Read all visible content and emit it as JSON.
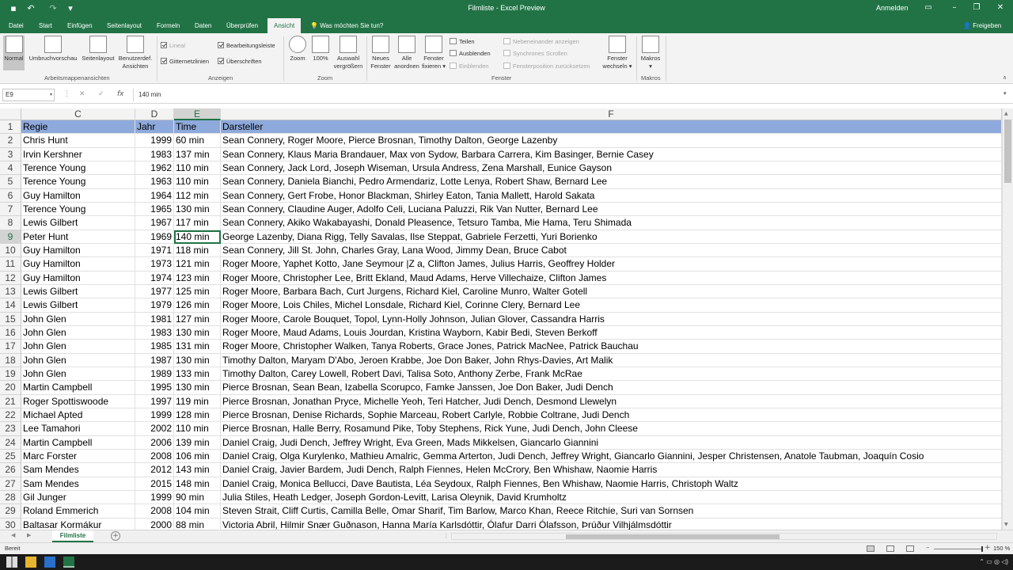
{
  "window": {
    "title": "Filmliste  -  Excel Preview",
    "signin": "Anmelden",
    "share": "Freigeben",
    "tell_me": "Was möchten Sie tun?"
  },
  "tabs": [
    {
      "label": "Datei"
    },
    {
      "label": "Start"
    },
    {
      "label": "Einfügen"
    },
    {
      "label": "Seitenlayout"
    },
    {
      "label": "Formeln"
    },
    {
      "label": "Daten"
    },
    {
      "label": "Überprüfen"
    },
    {
      "label": "Ansicht",
      "active": true
    }
  ],
  "ribbon": {
    "views": {
      "normal": "Normal",
      "pagebreak": "Umbruchvorschau",
      "pagelayout": "Seitenlayout",
      "custom_line1": "Benutzerdef.",
      "custom_line2": "Ansichten",
      "group": "Arbeitsmappenansichten"
    },
    "show": {
      "ruler": "Lineal",
      "formulabar": "Bearbeitungsleiste",
      "gridlines": "Gitternetzlinien",
      "headings": "Überschriften",
      "group": "Anzeigen"
    },
    "zoom": {
      "zoom": "Zoom",
      "hundred": "100%",
      "sel_line1": "Auswahl",
      "sel_line2": "vergrößern",
      "group": "Zoom"
    },
    "window": {
      "new_line1": "Neues",
      "new_line2": "Fenster",
      "arrange_line1": "Alle",
      "arrange_line2": "anordnen",
      "freeze_line1": "Fenster",
      "freeze_line2": "fixieren",
      "split": "Teilen",
      "hide": "Ausblenden",
      "unhide": "Einblenden",
      "side_by_side": "Nebeneinander anzeigen",
      "sync_scroll": "Synchrones Scrollen",
      "reset_pos": "Fensterposition zurücksetzen",
      "switch_line1": "Fenster",
      "switch_line2": "wechseln",
      "group": "Fenster"
    },
    "macros": {
      "label": "Makros",
      "group": "Makros"
    }
  },
  "formula_bar": {
    "name_box": "E9",
    "cancel": "✕",
    "enter": "✓",
    "fx": "fx",
    "value": "140 min"
  },
  "columns": [
    {
      "letter": "C"
    },
    {
      "letter": "D"
    },
    {
      "letter": "E",
      "selected": true
    },
    {
      "letter": "F"
    }
  ],
  "rows": [
    {
      "n": "1",
      "c": "Regie",
      "d": "Jahr",
      "e": "Time",
      "f": "Darsteller"
    },
    {
      "n": "2",
      "c": "Chris Hunt",
      "d": "1999",
      "e": "60 min",
      "f": "Sean Connery, Roger Moore, Pierce Brosnan, Timothy Dalton, George Lazenby"
    },
    {
      "n": "3",
      "c": "Irvin Kershner",
      "d": "1983",
      "e": "137 min",
      "f": "Sean Connery, Klaus Maria Brandauer, Max von Sydow, Barbara Carrera, Kim Basinger, Bernie Casey"
    },
    {
      "n": "4",
      "c": "Terence Young",
      "d": "1962",
      "e": "110 min",
      "f": "Sean Connery, Jack Lord, Joseph Wiseman, Ursula Andress, Zena Marshall, Eunice Gayson"
    },
    {
      "n": "5",
      "c": "Terence Young",
      "d": "1963",
      "e": "110 min",
      "f": "Sean Connery, Daniela Bianchi, Pedro Armendariz, Lotte Lenya, Robert Shaw, Bernard Lee"
    },
    {
      "n": "6",
      "c": "Guy Hamilton",
      "d": "1964",
      "e": "112 min",
      "f": "Sean Connery, Gert Frobe, Honor Blackman, Shirley Eaton, Tania Mallett, Harold Sakata"
    },
    {
      "n": "7",
      "c": "Terence Young",
      "d": "1965",
      "e": "130 min",
      "f": "Sean Connery, Claudine Auger, Adolfo Celi, Luciana Paluzzi, Rik Van Nutter, Bernard Lee"
    },
    {
      "n": "8",
      "c": "Lewis Gilbert",
      "d": "1967",
      "e": "117 min",
      "f": "Sean Connery, Akiko Wakabayashi, Donald Pleasence, Tetsuro Tamba, Mie Hama, Teru Shimada"
    },
    {
      "n": "9",
      "c": "Peter Hunt",
      "d": "1969",
      "e": "140 min",
      "f": "George Lazenby, Diana Rigg, Telly Savalas, Ilse Steppat, Gabriele Ferzetti, Yuri Borienko"
    },
    {
      "n": "10",
      "c": "Guy Hamilton",
      "d": "1971",
      "e": "118 min",
      "f": "Sean Connery, Jill St. John, Charles Gray, Lana Wood, Jimmy Dean, Bruce Cabot"
    },
    {
      "n": "11",
      "c": "Guy Hamilton",
      "d": "1973",
      "e": "121 min",
      "f": "Roger Moore, Yaphet Kotto, Jane Seymour |Z a, Clifton James, Julius Harris, Geoffrey Holder"
    },
    {
      "n": "12",
      "c": "Guy Hamilton",
      "d": "1974",
      "e": "123 min",
      "f": "Roger Moore, Christopher Lee, Britt Ekland, Maud Adams, Herve Villechaize, Clifton James"
    },
    {
      "n": "13",
      "c": "Lewis Gilbert",
      "d": "1977",
      "e": "125 min",
      "f": "Roger Moore, Barbara Bach, Curt Jurgens, Richard Kiel, Caroline Munro, Walter Gotell"
    },
    {
      "n": "14",
      "c": "Lewis Gilbert",
      "d": "1979",
      "e": "126 min",
      "f": "Roger Moore, Lois Chiles, Michel Lonsdale, Richard Kiel, Corinne Clery, Bernard Lee"
    },
    {
      "n": "15",
      "c": "John Glen",
      "d": "1981",
      "e": "127 min",
      "f": "Roger Moore, Carole Bouquet, Topol, Lynn-Holly Johnson, Julian Glover, Cassandra Harris"
    },
    {
      "n": "16",
      "c": "John Glen",
      "d": "1983",
      "e": "130 min",
      "f": "Roger Moore, Maud Adams, Louis Jourdan, Kristina Wayborn, Kabir Bedi, Steven Berkoff"
    },
    {
      "n": "17",
      "c": "John Glen",
      "d": "1985",
      "e": "131 min",
      "f": "Roger Moore, Christopher Walken, Tanya Roberts, Grace Jones, Patrick MacNee, Patrick Bauchau"
    },
    {
      "n": "18",
      "c": "John Glen",
      "d": "1987",
      "e": "130 min",
      "f": "Timothy Dalton, Maryam D'Abo, Jeroen Krabbe, Joe Don Baker, John Rhys-Davies, Art Malik"
    },
    {
      "n": "19",
      "c": "John Glen",
      "d": "1989",
      "e": "133 min",
      "f": "Timothy Dalton, Carey Lowell, Robert Davi, Talisa Soto, Anthony Zerbe, Frank McRae"
    },
    {
      "n": "20",
      "c": "Martin Campbell",
      "d": "1995",
      "e": "130 min",
      "f": "Pierce Brosnan, Sean Bean, Izabella Scorupco, Famke Janssen, Joe Don Baker, Judi Dench"
    },
    {
      "n": "21",
      "c": "Roger Spottiswoode",
      "d": "1997",
      "e": "119 min",
      "f": "Pierce Brosnan, Jonathan Pryce, Michelle Yeoh, Teri Hatcher, Judi Dench, Desmond Llewelyn"
    },
    {
      "n": "22",
      "c": "Michael Apted",
      "d": "1999",
      "e": "128 min",
      "f": "Pierce Brosnan, Denise Richards, Sophie Marceau, Robert Carlyle, Robbie Coltrane, Judi Dench"
    },
    {
      "n": "23",
      "c": "Lee Tamahori",
      "d": "2002",
      "e": "110 min",
      "f": "Pierce Brosnan, Halle Berry, Rosamund Pike, Toby Stephens, Rick Yune, Judi Dench, John Cleese"
    },
    {
      "n": "24",
      "c": "Martin Campbell",
      "d": "2006",
      "e": "139 min",
      "f": "Daniel Craig, Judi Dench, Jeffrey Wright, Eva Green, Mads Mikkelsen, Giancarlo Giannini"
    },
    {
      "n": "25",
      "c": "Marc Forster",
      "d": "2008",
      "e": "106 min",
      "f": "Daniel Craig, Olga Kurylenko, Mathieu Amalric, Gemma Arterton, Judi Dench, Jeffrey Wright, Giancarlo Giannini, Jesper Christensen, Anatole Taubman, Joaquín Cosio"
    },
    {
      "n": "26",
      "c": "Sam Mendes",
      "d": "2012",
      "e": "143 min",
      "f": "Daniel Craig, Javier Bardem, Judi Dench, Ralph Fiennes, Helen McCrory, Ben Whishaw, Naomie Harris"
    },
    {
      "n": "27",
      "c": "Sam Mendes",
      "d": "2015",
      "e": "148 min",
      "f": "Daniel Craig, Monica Bellucci, Dave Bautista, Léa Seydoux, Ralph Fiennes, Ben Whishaw, Naomie Harris, Christoph Waltz"
    },
    {
      "n": "28",
      "c": "Gil Junger",
      "d": "1999",
      "e": "90 min",
      "f": "Julia Stiles, Heath Ledger, Joseph Gordon-Levitt, Larisa Oleynik, David Krumholtz"
    },
    {
      "n": "29",
      "c": "Roland Emmerich",
      "d": "2008",
      "e": "104 min",
      "f": "Steven Strait, Cliff Curtis, Camilla Belle, Omar Sharif, Tim Barlow, Marco Khan, Reece Ritchie, Suri van Sornsen"
    },
    {
      "n": "30",
      "c": "Baltasar Kormákur",
      "d": "2000",
      "e": "88 min",
      "f": "Victoria Abril, Hilmir Snær Guðnason, Hanna María Karlsdóttir, Ólafur Darri Ólafsson, Þrúður Vilhjálmsdóttir"
    }
  ],
  "active_cell": {
    "row": "9",
    "col": "E"
  },
  "sheet_tabs": [
    {
      "label": "Filmliste",
      "active": true
    }
  ],
  "status": {
    "text": "Bereit",
    "zoom": "150 %",
    "zoom_fraction": 0.5
  },
  "colors": {
    "accent": "#217346",
    "header_fill": "#8ea9db"
  }
}
